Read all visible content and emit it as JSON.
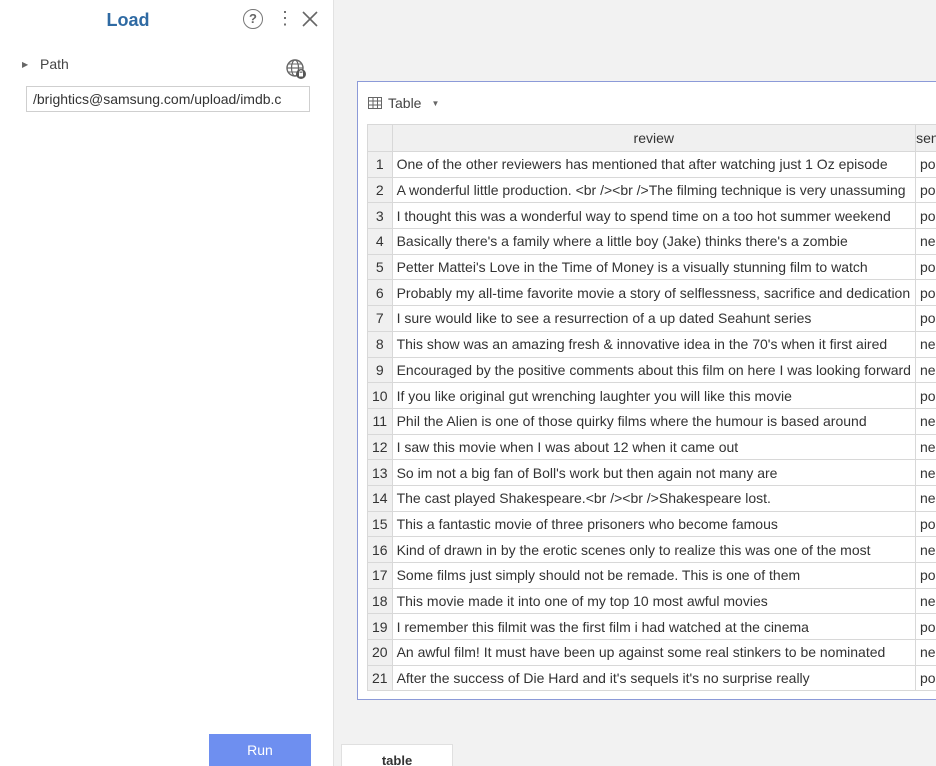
{
  "panel": {
    "title": "Load",
    "help_glyph": "?",
    "more_glyph": "⋮",
    "path_label": "Path",
    "path_value": "/brightics@samsung.com/upload/imdb.c",
    "run_label": "Run"
  },
  "table": {
    "label": "Table",
    "columns": [
      "review",
      "sentiment"
    ],
    "rows": [
      {
        "index": "1",
        "review": "One of the other reviewers has mentioned that after watching just 1 Oz episode",
        "sentiment": "positive"
      },
      {
        "index": "2",
        "review": "A wonderful little production. <br /><br />The filming technique is very unassuming",
        "sentiment": "positive"
      },
      {
        "index": "3",
        "review": "I thought this was a wonderful way to spend time on a too hot summer weekend",
        "sentiment": "positive"
      },
      {
        "index": "4",
        "review": "Basically there's a family where a little boy (Jake) thinks there's a zombie",
        "sentiment": "negative"
      },
      {
        "index": "5",
        "review": "Petter Mattei's Love in the Time of Money is a visually stunning film to watch",
        "sentiment": "positive"
      },
      {
        "index": "6",
        "review": "Probably my all-time favorite movie a story of selflessness, sacrifice and dedication",
        "sentiment": "positive"
      },
      {
        "index": "7",
        "review": "I sure would like to see a resurrection of a up dated Seahunt series",
        "sentiment": "positive"
      },
      {
        "index": "8",
        "review": "This show was an amazing fresh & innovative idea in the 70's when it first aired",
        "sentiment": "negative"
      },
      {
        "index": "9",
        "review": "Encouraged by the positive comments about this film on here I was looking forward",
        "sentiment": "negative"
      },
      {
        "index": "10",
        "review": "If you like original gut wrenching laughter you will like this movie",
        "sentiment": "positive"
      },
      {
        "index": "11",
        "review": "Phil the Alien is one of those quirky films where the humour is based around",
        "sentiment": "negative"
      },
      {
        "index": "12",
        "review": "I saw this movie when I was about 12 when it came out",
        "sentiment": "negative"
      },
      {
        "index": "13",
        "review": "So im not a big fan of Boll's work but then again not many are",
        "sentiment": "negative"
      },
      {
        "index": "14",
        "review": "The cast played Shakespeare.<br /><br />Shakespeare lost.",
        "sentiment": "negative"
      },
      {
        "index": "15",
        "review": "This a fantastic movie of three prisoners who become famous",
        "sentiment": "positive"
      },
      {
        "index": "16",
        "review": "Kind of drawn in by the erotic scenes only to realize this was one of the most",
        "sentiment": "negative"
      },
      {
        "index": "17",
        "review": "Some films just simply should not be remade. This is one of them",
        "sentiment": "positive"
      },
      {
        "index": "18",
        "review": "This movie made it into one of my top 10 most awful movies",
        "sentiment": "negative"
      },
      {
        "index": "19",
        "review": "I remember this filmit was the first film i had watched at the cinema",
        "sentiment": "positive"
      },
      {
        "index": "20",
        "review": "An awful film! It must have been up against some real stinkers to be nominated",
        "sentiment": "negative"
      },
      {
        "index": "21",
        "review": "After the success of Die Hard and it's sequels it's no surprise really",
        "sentiment": "positive"
      }
    ]
  },
  "bottom_tab": {
    "label": "table"
  },
  "colors": {
    "title": "#2f6aa3",
    "run_button": "#6e8ff0",
    "card_border": "#8c9ad8"
  },
  "icons": [
    "help-icon",
    "more-icon",
    "close-icon",
    "expand-caret-icon",
    "globe-icon",
    "table-grid-icon",
    "dropdown-caret-icon"
  ]
}
